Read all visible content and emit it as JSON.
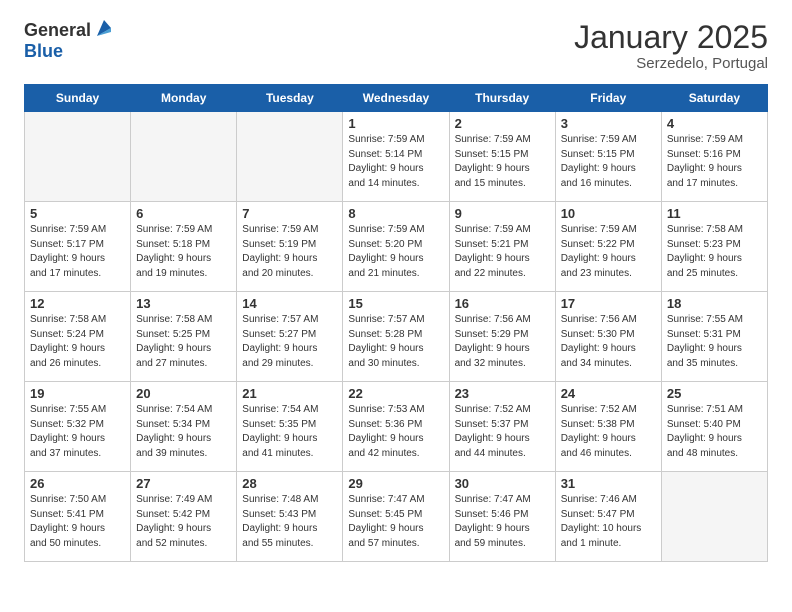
{
  "logo": {
    "general": "General",
    "blue": "Blue"
  },
  "title": "January 2025",
  "subtitle": "Serzedelo, Portugal",
  "days_of_week": [
    "Sunday",
    "Monday",
    "Tuesday",
    "Wednesday",
    "Thursday",
    "Friday",
    "Saturday"
  ],
  "weeks": [
    [
      {
        "day": "",
        "info": "",
        "empty": true
      },
      {
        "day": "",
        "info": "",
        "empty": true
      },
      {
        "day": "",
        "info": "",
        "empty": true
      },
      {
        "day": "1",
        "info": "Sunrise: 7:59 AM\nSunset: 5:14 PM\nDaylight: 9 hours\nand 14 minutes.",
        "empty": false
      },
      {
        "day": "2",
        "info": "Sunrise: 7:59 AM\nSunset: 5:15 PM\nDaylight: 9 hours\nand 15 minutes.",
        "empty": false
      },
      {
        "day": "3",
        "info": "Sunrise: 7:59 AM\nSunset: 5:15 PM\nDaylight: 9 hours\nand 16 minutes.",
        "empty": false
      },
      {
        "day": "4",
        "info": "Sunrise: 7:59 AM\nSunset: 5:16 PM\nDaylight: 9 hours\nand 17 minutes.",
        "empty": false
      }
    ],
    [
      {
        "day": "5",
        "info": "Sunrise: 7:59 AM\nSunset: 5:17 PM\nDaylight: 9 hours\nand 17 minutes.",
        "empty": false
      },
      {
        "day": "6",
        "info": "Sunrise: 7:59 AM\nSunset: 5:18 PM\nDaylight: 9 hours\nand 19 minutes.",
        "empty": false
      },
      {
        "day": "7",
        "info": "Sunrise: 7:59 AM\nSunset: 5:19 PM\nDaylight: 9 hours\nand 20 minutes.",
        "empty": false
      },
      {
        "day": "8",
        "info": "Sunrise: 7:59 AM\nSunset: 5:20 PM\nDaylight: 9 hours\nand 21 minutes.",
        "empty": false
      },
      {
        "day": "9",
        "info": "Sunrise: 7:59 AM\nSunset: 5:21 PM\nDaylight: 9 hours\nand 22 minutes.",
        "empty": false
      },
      {
        "day": "10",
        "info": "Sunrise: 7:59 AM\nSunset: 5:22 PM\nDaylight: 9 hours\nand 23 minutes.",
        "empty": false
      },
      {
        "day": "11",
        "info": "Sunrise: 7:58 AM\nSunset: 5:23 PM\nDaylight: 9 hours\nand 25 minutes.",
        "empty": false
      }
    ],
    [
      {
        "day": "12",
        "info": "Sunrise: 7:58 AM\nSunset: 5:24 PM\nDaylight: 9 hours\nand 26 minutes.",
        "empty": false
      },
      {
        "day": "13",
        "info": "Sunrise: 7:58 AM\nSunset: 5:25 PM\nDaylight: 9 hours\nand 27 minutes.",
        "empty": false
      },
      {
        "day": "14",
        "info": "Sunrise: 7:57 AM\nSunset: 5:27 PM\nDaylight: 9 hours\nand 29 minutes.",
        "empty": false
      },
      {
        "day": "15",
        "info": "Sunrise: 7:57 AM\nSunset: 5:28 PM\nDaylight: 9 hours\nand 30 minutes.",
        "empty": false
      },
      {
        "day": "16",
        "info": "Sunrise: 7:56 AM\nSunset: 5:29 PM\nDaylight: 9 hours\nand 32 minutes.",
        "empty": false
      },
      {
        "day": "17",
        "info": "Sunrise: 7:56 AM\nSunset: 5:30 PM\nDaylight: 9 hours\nand 34 minutes.",
        "empty": false
      },
      {
        "day": "18",
        "info": "Sunrise: 7:55 AM\nSunset: 5:31 PM\nDaylight: 9 hours\nand 35 minutes.",
        "empty": false
      }
    ],
    [
      {
        "day": "19",
        "info": "Sunrise: 7:55 AM\nSunset: 5:32 PM\nDaylight: 9 hours\nand 37 minutes.",
        "empty": false
      },
      {
        "day": "20",
        "info": "Sunrise: 7:54 AM\nSunset: 5:34 PM\nDaylight: 9 hours\nand 39 minutes.",
        "empty": false
      },
      {
        "day": "21",
        "info": "Sunrise: 7:54 AM\nSunset: 5:35 PM\nDaylight: 9 hours\nand 41 minutes.",
        "empty": false
      },
      {
        "day": "22",
        "info": "Sunrise: 7:53 AM\nSunset: 5:36 PM\nDaylight: 9 hours\nand 42 minutes.",
        "empty": false
      },
      {
        "day": "23",
        "info": "Sunrise: 7:52 AM\nSunset: 5:37 PM\nDaylight: 9 hours\nand 44 minutes.",
        "empty": false
      },
      {
        "day": "24",
        "info": "Sunrise: 7:52 AM\nSunset: 5:38 PM\nDaylight: 9 hours\nand 46 minutes.",
        "empty": false
      },
      {
        "day": "25",
        "info": "Sunrise: 7:51 AM\nSunset: 5:40 PM\nDaylight: 9 hours\nand 48 minutes.",
        "empty": false
      }
    ],
    [
      {
        "day": "26",
        "info": "Sunrise: 7:50 AM\nSunset: 5:41 PM\nDaylight: 9 hours\nand 50 minutes.",
        "empty": false
      },
      {
        "day": "27",
        "info": "Sunrise: 7:49 AM\nSunset: 5:42 PM\nDaylight: 9 hours\nand 52 minutes.",
        "empty": false
      },
      {
        "day": "28",
        "info": "Sunrise: 7:48 AM\nSunset: 5:43 PM\nDaylight: 9 hours\nand 55 minutes.",
        "empty": false
      },
      {
        "day": "29",
        "info": "Sunrise: 7:47 AM\nSunset: 5:45 PM\nDaylight: 9 hours\nand 57 minutes.",
        "empty": false
      },
      {
        "day": "30",
        "info": "Sunrise: 7:47 AM\nSunset: 5:46 PM\nDaylight: 9 hours\nand 59 minutes.",
        "empty": false
      },
      {
        "day": "31",
        "info": "Sunrise: 7:46 AM\nSunset: 5:47 PM\nDaylight: 10 hours\nand 1 minute.",
        "empty": false
      },
      {
        "day": "",
        "info": "",
        "empty": true
      }
    ]
  ]
}
